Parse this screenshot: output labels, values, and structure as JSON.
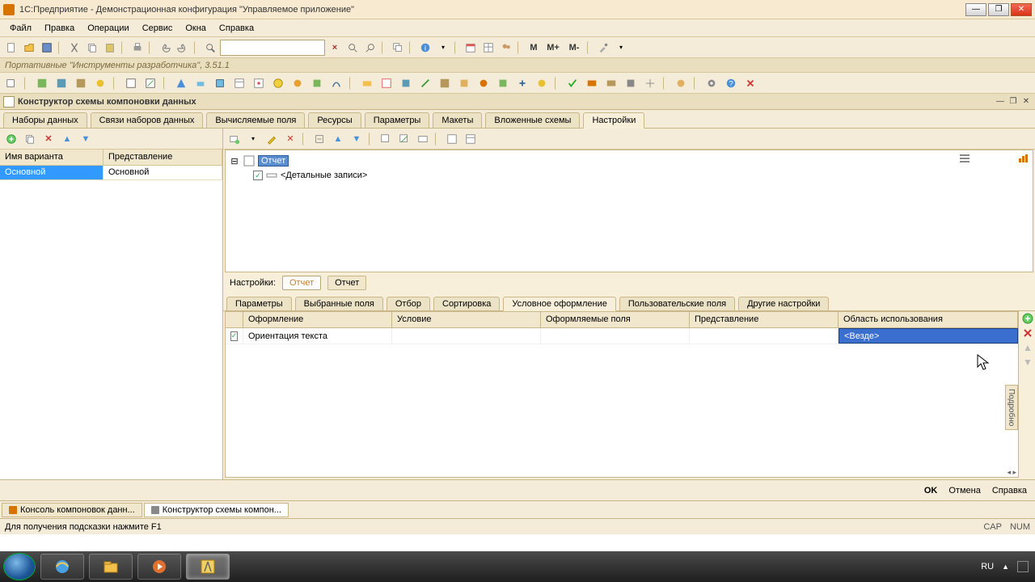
{
  "title": "1С:Предприятие - Демонстрационная конфигурация \"Управляемое приложение\"",
  "menu": [
    "Файл",
    "Правка",
    "Операции",
    "Сервис",
    "Окна",
    "Справка"
  ],
  "info_line": "Портативные \"Инструменты разработчика\", 3.51.1",
  "mem_buttons": [
    "M",
    "M+",
    "M-"
  ],
  "subwin_title": "Конструктор схемы компоновки данных",
  "top_tabs": [
    "Наборы данных",
    "Связи наборов данных",
    "Вычисляемые поля",
    "Ресурсы",
    "Параметры",
    "Макеты",
    "Вложенные схемы",
    "Настройки"
  ],
  "top_tabs_active": 7,
  "left": {
    "headers": [
      "Имя варианта",
      "Представление"
    ],
    "row": [
      "Основной",
      "Основной"
    ]
  },
  "tree": {
    "root": "Отчет",
    "child": "<Детальные записи>"
  },
  "settings_label": "Настройки:",
  "settings_crumbs": [
    "Отчет",
    "Отчет"
  ],
  "tabs2": [
    "Параметры",
    "Выбранные поля",
    "Отбор",
    "Сортировка",
    "Условное оформление",
    "Пользовательские поля",
    "Другие настройки"
  ],
  "tabs2_active": 4,
  "grid": {
    "headers": [
      "",
      "Оформление",
      "Условие",
      "Оформляемые поля",
      "Представление",
      "Область использования"
    ],
    "row": {
      "checked": true,
      "format": "Ориентация текста",
      "condition": "",
      "fields": "",
      "presentation": "",
      "area": "<Везде>"
    }
  },
  "vert_label": "Подробно",
  "dlg": {
    "ok": "OK",
    "cancel": "Отмена",
    "help": "Справка"
  },
  "wnd_tabs": [
    "Консоль компоновок данн...",
    "Конструктор схемы компон..."
  ],
  "status_hint": "Для получения подсказки нажмите F1",
  "status_right": [
    "CAP",
    "NUM"
  ],
  "tray_lang": "RU"
}
